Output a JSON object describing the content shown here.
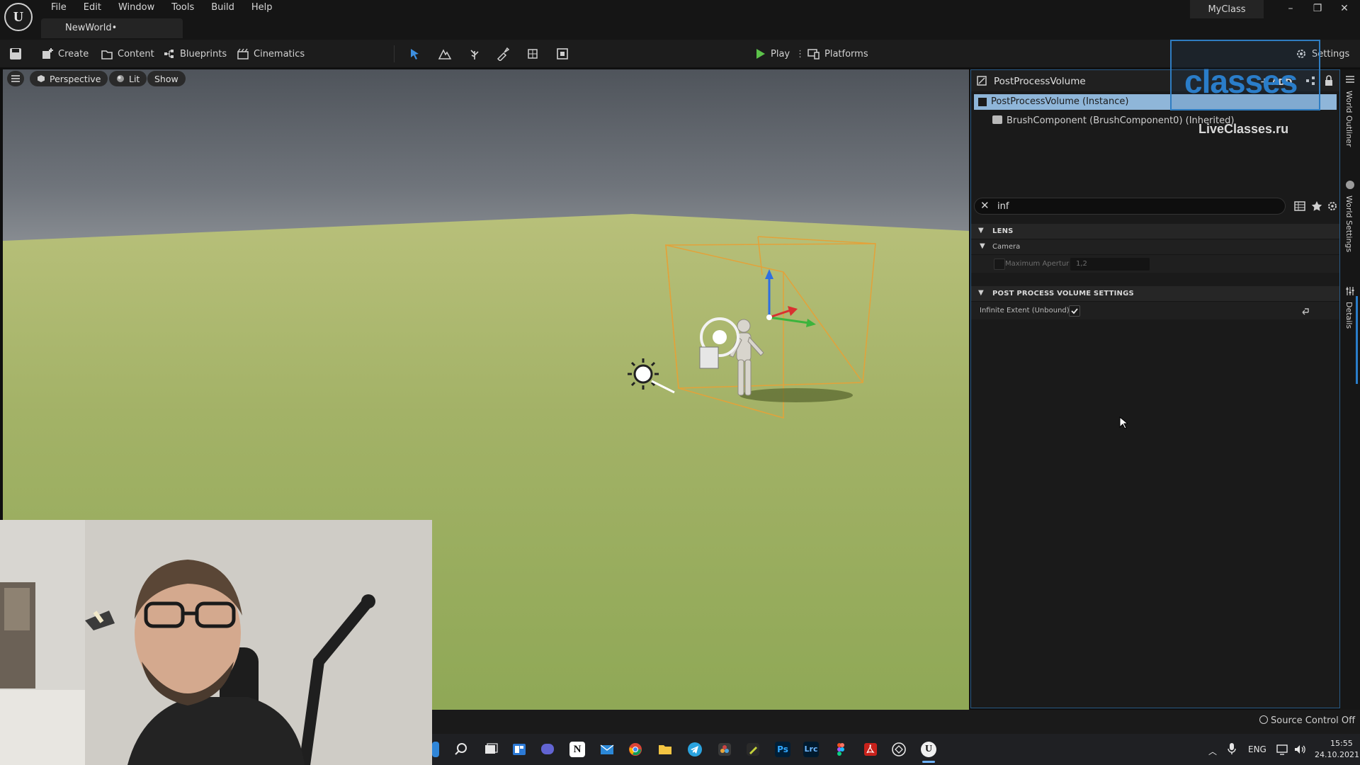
{
  "titlebar": {
    "menu": [
      "File",
      "Edit",
      "Window",
      "Tools",
      "Build",
      "Help"
    ],
    "doc_tab": "NewWorld•",
    "project": "MyClass",
    "minimize": "–",
    "restore": "❐",
    "close": "✕"
  },
  "toolbar": {
    "create": "Create",
    "content": "Content",
    "blueprints": "Blueprints",
    "cinematics": "Cinematics",
    "play": "Play",
    "platforms": "Platforms",
    "settings": "Settings"
  },
  "viewport": {
    "perspective": "Perspective",
    "lit": "Lit",
    "show": "Show"
  },
  "details": {
    "title": "PostProcessVolume",
    "add": "ADD",
    "component_selected": "PostProcessVolume (Instance)",
    "component_child": "BrushComponent (BrushComponent0) (Inherited)",
    "search_value": "inf",
    "categories": {
      "lens": "LENS",
      "camera": "Camera",
      "max_aperture_label": "Maximum Apertur",
      "max_aperture_value": "1,2",
      "ppv_settings": "POST PROCESS VOLUME SETTINGS",
      "infinite_extent": "Infinite Extent (Unbound)",
      "infinite_extent_checked": true
    }
  },
  "side_tabs": [
    "World Outliner",
    "World Settings",
    "Details"
  ],
  "watermark": {
    "logo": "classes",
    "site": "LiveClasses.ru"
  },
  "statusbar": {
    "source_control": "Source Control Off"
  },
  "taskbar": {
    "lang": "ENG",
    "time": "15:55",
    "date": "24.10.2021"
  },
  "colors": {
    "accent_blue": "#2a7dc9",
    "selection_row": "#8fb6d9",
    "play_green": "#5cc24a",
    "bounds_orange": "#e3a23a"
  }
}
